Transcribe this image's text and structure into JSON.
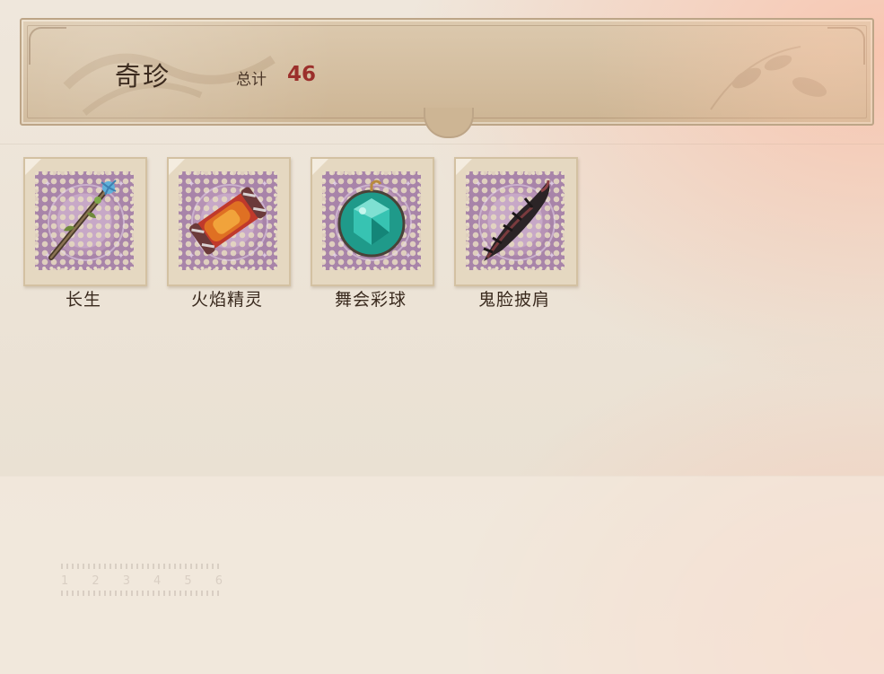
{
  "header": {
    "title": "奇珍",
    "total_label": "总计",
    "total_value": "46"
  },
  "items": [
    {
      "name": "长生",
      "icon": "staff-icon"
    },
    {
      "name": "火焰精灵",
      "icon": "flame-scroll-icon"
    },
    {
      "name": "舞会彩球",
      "icon": "crystal-ball-icon"
    },
    {
      "name": "鬼脸披肩",
      "icon": "ghost-shawl-icon"
    }
  ],
  "ruler": {
    "numbers": [
      "1",
      "2",
      "3",
      "4",
      "5",
      "6"
    ]
  },
  "colors": {
    "header_bg": "#cdb594",
    "total_value": "#9b2f2b",
    "stamp_purple": "#a884a9"
  }
}
